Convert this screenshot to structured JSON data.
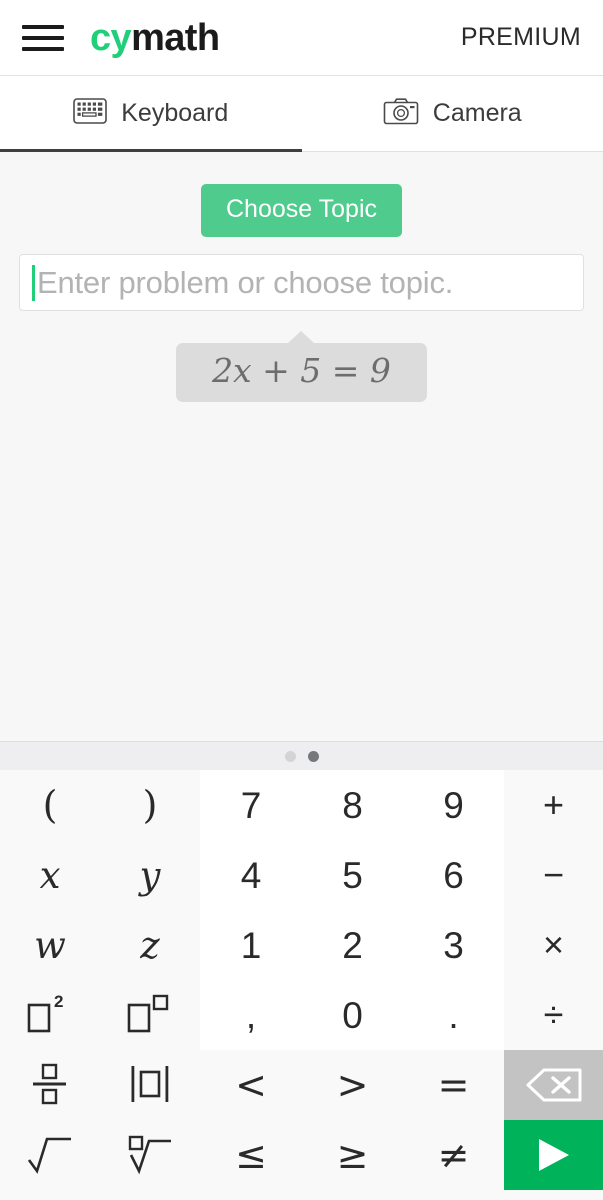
{
  "header": {
    "menu_icon": "hamburger-menu-icon",
    "logo_part1": "cy",
    "logo_part2": "math",
    "logo_accent_color": "#21ce7a",
    "premium_label": "PREMIUM"
  },
  "tabs": [
    {
      "label": "Keyboard",
      "icon": "keyboard-icon",
      "active": true
    },
    {
      "label": "Camera",
      "icon": "camera-icon",
      "active": false
    }
  ],
  "main": {
    "choose_topic_label": "Choose Topic",
    "choose_topic_color": "#4ecb8d",
    "input_value": "",
    "input_placeholder": "Enter problem or choose topic.",
    "caret_color": "#21ce7a",
    "example_equation": "2x + 5 = 9"
  },
  "pager": {
    "dots": 2,
    "active_index": 1
  },
  "keyboard": {
    "rows": [
      [
        {
          "label": "(",
          "name": "key-open-paren",
          "style": "paren"
        },
        {
          "label": ")",
          "name": "key-close-paren",
          "style": "paren"
        },
        {
          "label": "7",
          "name": "key-7",
          "style": "num"
        },
        {
          "label": "8",
          "name": "key-8",
          "style": "num"
        },
        {
          "label": "9",
          "name": "key-9",
          "style": "num"
        },
        {
          "label": "+",
          "name": "key-plus",
          "style": "op"
        }
      ],
      [
        {
          "label": "x",
          "name": "key-var-x",
          "style": "var"
        },
        {
          "label": "y",
          "name": "key-var-y",
          "style": "var"
        },
        {
          "label": "4",
          "name": "key-4",
          "style": "num"
        },
        {
          "label": "5",
          "name": "key-5",
          "style": "num"
        },
        {
          "label": "6",
          "name": "key-6",
          "style": "num"
        },
        {
          "label": "−",
          "name": "key-minus",
          "style": "op"
        }
      ],
      [
        {
          "label": "w",
          "name": "key-var-w",
          "style": "var"
        },
        {
          "label": "z",
          "name": "key-var-z",
          "style": "var"
        },
        {
          "label": "1",
          "name": "key-1",
          "style": "num"
        },
        {
          "label": "2",
          "name": "key-2",
          "style": "num"
        },
        {
          "label": "3",
          "name": "key-3",
          "style": "num"
        },
        {
          "label": "×",
          "name": "key-multiply",
          "style": "op"
        }
      ],
      [
        {
          "label": "□²",
          "name": "key-square",
          "style": "glyph-square"
        },
        {
          "label": "□^□",
          "name": "key-power",
          "style": "glyph-power"
        },
        {
          "label": ",",
          "name": "key-comma",
          "style": "punct"
        },
        {
          "label": "0",
          "name": "key-0",
          "style": "num"
        },
        {
          "label": ".",
          "name": "key-decimal-point",
          "style": "punct"
        },
        {
          "label": "÷",
          "name": "key-divide",
          "style": "op"
        }
      ],
      [
        {
          "label": "□/□",
          "name": "key-fraction",
          "style": "glyph-fraction"
        },
        {
          "label": "|□|",
          "name": "key-absolute-value",
          "style": "glyph-abs"
        },
        {
          "label": "<",
          "name": "key-less-than",
          "style": "rel"
        },
        {
          "label": ">",
          "name": "key-greater-than",
          "style": "rel"
        },
        {
          "label": "=",
          "name": "key-equals",
          "style": "rel"
        },
        {
          "label": "backspace",
          "name": "key-backspace",
          "style": "backspace"
        }
      ],
      [
        {
          "label": "√□",
          "name": "key-square-root",
          "style": "glyph-sqrt"
        },
        {
          "label": "□√□",
          "name": "key-nth-root",
          "style": "glyph-nthroot"
        },
        {
          "label": "≤",
          "name": "key-less-equal",
          "style": "rel"
        },
        {
          "label": "≥",
          "name": "key-greater-equal",
          "style": "rel"
        },
        {
          "label": "≠",
          "name": "key-not-equal",
          "style": "rel"
        },
        {
          "label": "submit",
          "name": "key-submit",
          "style": "submit"
        }
      ]
    ],
    "backspace_icon": "backspace-icon",
    "submit_icon": "play-triangle-icon",
    "submit_color": "#00b259",
    "backspace_color": "#c3c3c3"
  }
}
